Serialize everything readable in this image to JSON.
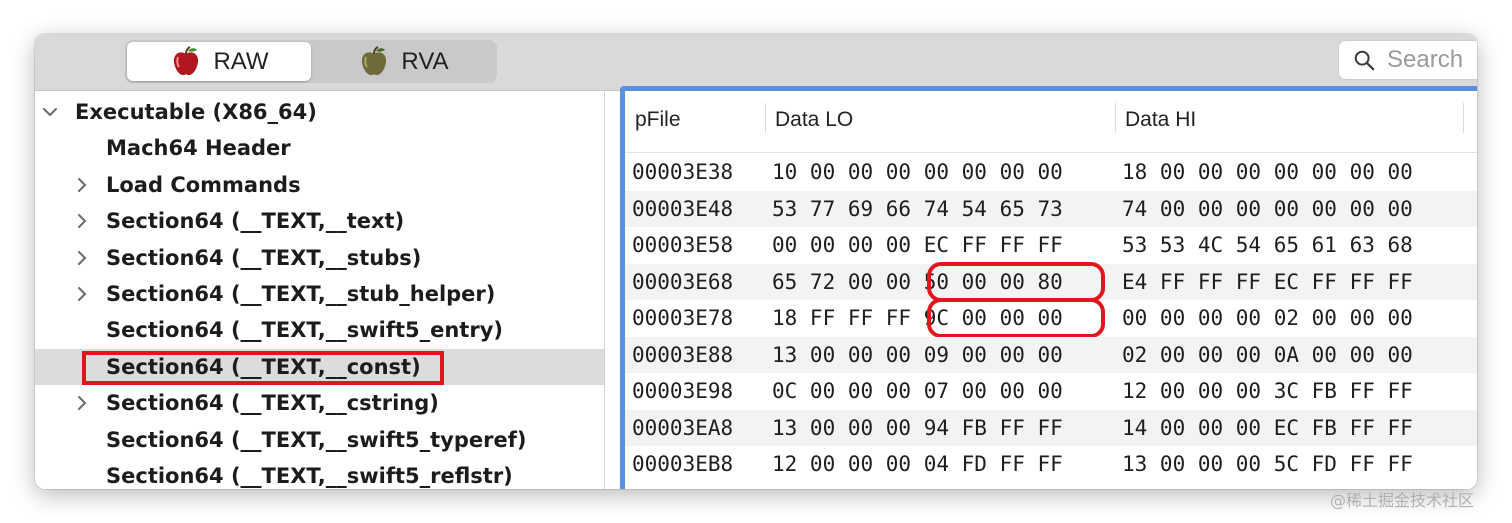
{
  "toolbar": {
    "seg_raw": "RAW",
    "seg_rva": "RVA",
    "search_placeholder": "Search"
  },
  "sidebar": {
    "items": [
      {
        "label": "Executable  (X86_64)",
        "chevron": "down",
        "level": 0
      },
      {
        "label": "Mach64 Header",
        "chevron": "none",
        "level": 1
      },
      {
        "label": "Load Commands",
        "chevron": "right",
        "level": 1
      },
      {
        "label": "Section64 (__TEXT,__text)",
        "chevron": "right",
        "level": 1
      },
      {
        "label": "Section64 (__TEXT,__stubs)",
        "chevron": "right",
        "level": 1
      },
      {
        "label": "Section64 (__TEXT,__stub_helper)",
        "chevron": "right",
        "level": 1
      },
      {
        "label": "Section64 (__TEXT,__swift5_entry)",
        "chevron": "none",
        "level": 1
      },
      {
        "label": "Section64 (__TEXT,__const)",
        "chevron": "none",
        "level": 1,
        "selected": true
      },
      {
        "label": "Section64 (__TEXT,__cstring)",
        "chevron": "right",
        "level": 1
      },
      {
        "label": "Section64 (__TEXT,__swift5_typeref)",
        "chevron": "none",
        "level": 1
      },
      {
        "label": "Section64 (__TEXT,__swift5_reflstr)",
        "chevron": "none",
        "level": 1
      }
    ]
  },
  "table": {
    "columns": [
      "pFile",
      "Data LO",
      "Data HI"
    ],
    "rows": [
      {
        "pfile": "00003E38",
        "lo": "10 00 00 00 00 00 00 00",
        "hi": "18 00 00 00 00 00 00 00"
      },
      {
        "pfile": "00003E48",
        "lo": "53 77 69 66 74 54 65 73",
        "hi": "74 00 00 00 00 00 00 00"
      },
      {
        "pfile": "00003E58",
        "lo": "00 00 00 00 EC FF FF FF",
        "hi": "53 53 4C 54 65 61 63 68"
      },
      {
        "pfile": "00003E68",
        "lo": "65 72 00 00 50 00 00 80",
        "hi": "E4 FF FF FF EC FF FF FF",
        "highlight": true
      },
      {
        "pfile": "00003E78",
        "lo": "18 FF FF FF 9C 00 00 00",
        "hi": "00 00 00 00 02 00 00 00",
        "highlight": true
      },
      {
        "pfile": "00003E88",
        "lo": "13 00 00 00 09 00 00 00",
        "hi": "02 00 00 00 0A 00 00 00"
      },
      {
        "pfile": "00003E98",
        "lo": "0C 00 00 00 07 00 00 00",
        "hi": "12 00 00 00 3C FB FF FF"
      },
      {
        "pfile": "00003EA8",
        "lo": "13 00 00 00 94 FB FF FF",
        "hi": "14 00 00 00 EC FB FF FF"
      },
      {
        "pfile": "00003EB8",
        "lo": "12 00 00 00 04 FD FF FF",
        "hi": "13 00 00 00 5C FD FF FF"
      }
    ]
  },
  "watermark": "@稀土掘金技术社区",
  "colors": {
    "highlight_red": "#e0161d",
    "table_focus_blue": "#5b8fe0",
    "selected_row": "#dcdcdc"
  }
}
